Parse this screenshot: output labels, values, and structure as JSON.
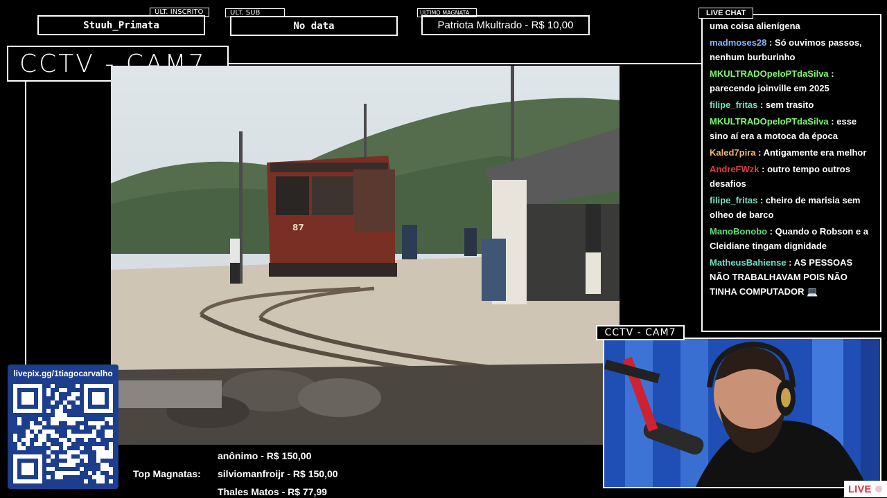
{
  "top_stats": {
    "last_follower": {
      "tag": "ULT. INSCRITO",
      "value": "Stuuh_Primata"
    },
    "last_sub": {
      "tag": "ULT. SUB",
      "value": "No data"
    },
    "last_magnata": {
      "tag": "ULTIMO MAGNATA",
      "value": "Patriota Mkultrado - R$ 10,00"
    }
  },
  "camera_main": {
    "title": "CCTV - CAM7"
  },
  "camera_small": {
    "title": "CCTV - CAM7"
  },
  "video": {
    "tram_number": "87"
  },
  "chat": {
    "title": "LIVE CHAT",
    "messages": [
      {
        "user": "",
        "color": "#ffffff",
        "text": "uma coisa alienígena"
      },
      {
        "user": "madmoses28",
        "color": "#8ab4f8",
        "text": ": Só ouvimos passos, nenhum burburinho"
      },
      {
        "user": "MKULTRADOpeloPTdaSilva",
        "color": "#7cfc6c",
        "text": ": parecendo joinville em 2025"
      },
      {
        "user": "filipe_fritas",
        "color": "#6fe3c4",
        "text": ": sem trasito"
      },
      {
        "user": "MKULTRADOpeloPTdaSilva",
        "color": "#7cfc6c",
        "text": ": esse sino aí era a motoca da época"
      },
      {
        "user": "Kaled7pira",
        "color": "#f2b96a",
        "text": ": Antigamente era melhor"
      },
      {
        "user": "AndreFWzk",
        "color": "#e23b4a",
        "text": ": outro tempo outros desafios"
      },
      {
        "user": "filipe_fritas",
        "color": "#6fe3c4",
        "text": ": cheiro de marisia sem olheo de barco"
      },
      {
        "user": "ManoBonobo",
        "color": "#5ee07a",
        "text": ": Quando o Robson e a Cleidiane tingam dignidade"
      },
      {
        "user": "MatheusBahiense",
        "color": "#6fe3c4",
        "text": ": AS PESSOAS NÃO TRABALHAVAM POIS NÃO TINHA COMPUTADOR 💻"
      }
    ]
  },
  "live_badge": "LIVE",
  "donation": {
    "url": "livepix.gg/1tiagocarvalho"
  },
  "top_magnatas": {
    "label": "Top Magnatas:",
    "entries": [
      "anônimo - R$ 150,00",
      "silviomanfroijr - R$ 150,00",
      "Thales Matos - R$ 77,99"
    ]
  }
}
